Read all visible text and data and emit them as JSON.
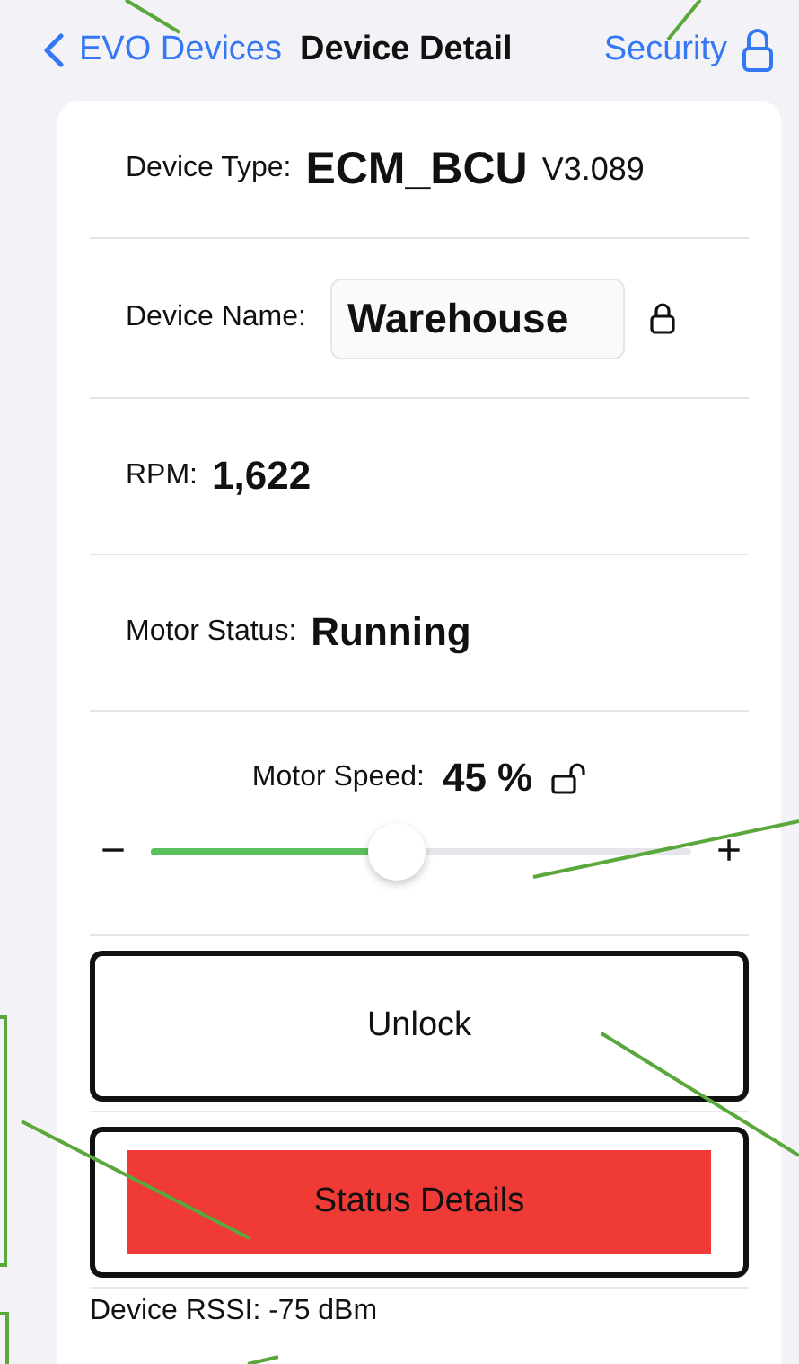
{
  "nav": {
    "back_label": "EVO Devices",
    "title": "Device Detail",
    "action_label": "Security",
    "action_locked": true
  },
  "device_type": {
    "label": "Device Type:",
    "value": "ECM_BCU",
    "version": "V3.089"
  },
  "device_name": {
    "label": "Device Name:",
    "value": "Warehouse",
    "locked": true
  },
  "rpm": {
    "label": "RPM:",
    "value": "1,622"
  },
  "motor_status": {
    "label": "Motor Status:",
    "value": "Running"
  },
  "motor_speed": {
    "label": "Motor Speed:",
    "value": "45 %",
    "locked": false,
    "minus": "−",
    "plus": "+",
    "level": 0.45
  },
  "buttons": [
    {
      "label": "Unlock",
      "kind": "plain"
    },
    {
      "label": "Status Details",
      "kind": "alert"
    }
  ],
  "rssi": {
    "label": "Device RSSI:",
    "value": "-75 dBm"
  }
}
